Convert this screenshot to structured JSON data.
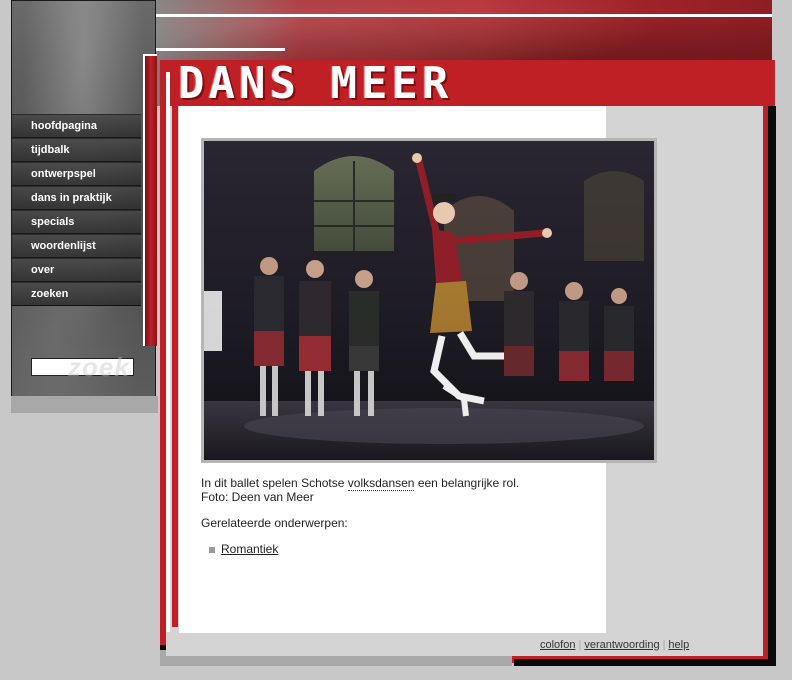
{
  "logo": {
    "text": "DANS MEER"
  },
  "nav": {
    "items": [
      {
        "label": "hoofdpagina"
      },
      {
        "label": "tijdbalk"
      },
      {
        "label": "ontwerpspel"
      },
      {
        "label": "dans in praktijk"
      },
      {
        "label": "specials"
      },
      {
        "label": "woordenlijst"
      },
      {
        "label": "over"
      },
      {
        "label": "zoeken"
      }
    ]
  },
  "search": {
    "watermark": "zoek",
    "value": ""
  },
  "photo": {
    "caption_before": "In dit ballet spelen Schotse ",
    "caption_link": "volksdansen",
    "caption_after": " een belangrijke rol.",
    "credit": "Foto: Deen van Meer"
  },
  "related": {
    "heading": "Gerelateerde onderwerpen:",
    "items": [
      {
        "label": "Romantiek"
      }
    ]
  },
  "footer": {
    "colofon": "colofon",
    "verantwoording": "verantwoording",
    "help": "help",
    "separator": "|"
  },
  "colors": {
    "accent_red": "#bf2026",
    "frame_grey": "#d4d4d4",
    "nav_dark": "#3a3a3a"
  }
}
